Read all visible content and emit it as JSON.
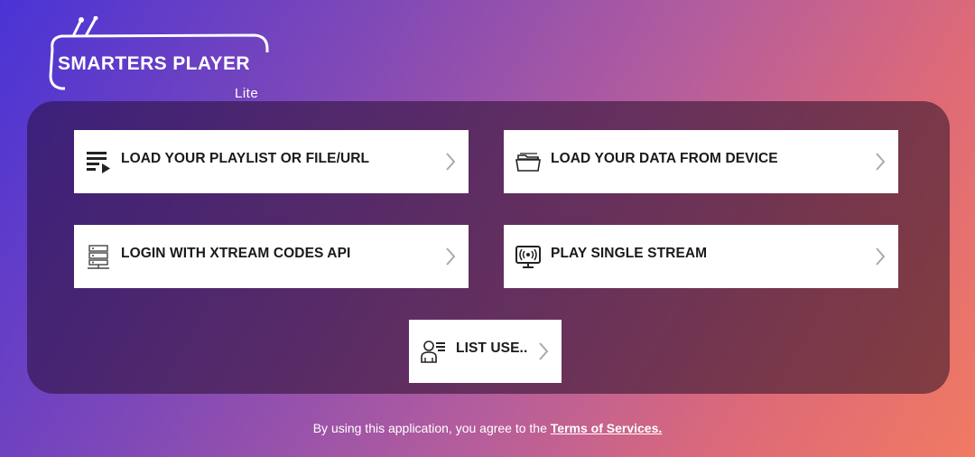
{
  "app": {
    "logo_title": "SMARTERS PLAYER",
    "logo_subtitle": "Lite"
  },
  "menu": {
    "items": [
      {
        "label": "LOAD YOUR PLAYLIST OR FILE/URL",
        "icon": "playlist-icon"
      },
      {
        "label": "LOAD YOUR DATA FROM DEVICE",
        "icon": "folder-icon"
      },
      {
        "label": "LOGIN WITH XTREAM CODES API",
        "icon": "server-icon"
      },
      {
        "label": "PLAY SINGLE STREAM",
        "icon": "stream-icon"
      },
      {
        "label": "LIST USE..",
        "icon": "user-list-icon"
      }
    ]
  },
  "footer": {
    "text": "By using this application, you agree to the ",
    "link": "Terms of Services."
  },
  "colors": {
    "gradient_start": "#4a33d6",
    "gradient_end": "#f07a62",
    "card_bg": "#ffffff",
    "text_dark": "#1a1a1a"
  }
}
